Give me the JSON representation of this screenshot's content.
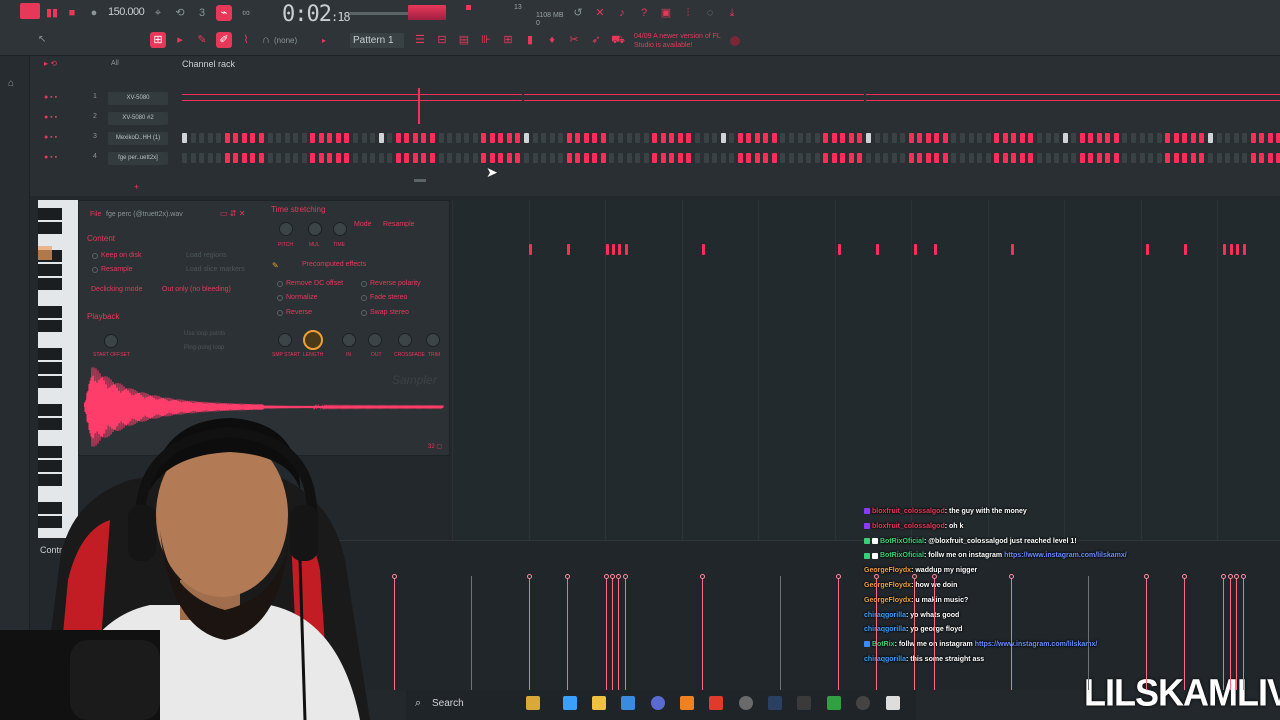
{
  "toolbar": {
    "tempo": "150.000",
    "time": "0:02",
    "time_frac": ":18",
    "cpu": "13",
    "memory": "1108 MB",
    "mem_sub": "0",
    "snap_label": "(none)",
    "pattern_label": "Pattern 1",
    "update_notice": "04/09 A newer version of FL Studio is available!",
    "accent_color": "#e8385a"
  },
  "rack": {
    "title": "Channel rack",
    "filter": "All",
    "channels": [
      {
        "num": "1",
        "name": "XV-5080"
      },
      {
        "num": "2",
        "name": "XV-5080 #2"
      },
      {
        "num": "3",
        "name": "MexikoD..HH (1)"
      },
      {
        "num": "4",
        "name": "fge per..uett2x]"
      }
    ]
  },
  "sampler": {
    "file_label": "File",
    "file_name": "fge perc (@truett2x).wav",
    "content_label": "Content",
    "keep_on_disk": "Keep on disk",
    "resample": "Resample",
    "load_regions": "Load regions",
    "load_slice_markers": "Load slice markers",
    "declicking_label": "Declicking mode",
    "declicking_value": "Out only (no bleeding)",
    "playback_label": "Playback",
    "use_loop_points": "Use loop points",
    "ping_pong_loop": "Ping-pong loop",
    "start_offset": "START OFFSET",
    "time_stretching": "Time stretching",
    "mode_label": "Mode",
    "mode_value": "Resample",
    "pitch": "PITCH",
    "mul": "MUL",
    "time": "TIME",
    "precomputed": "Precomputed effects",
    "remove_dc": "Remove DC offset",
    "reverse_polarity": "Reverse polarity",
    "normalize": "Normalize",
    "fade_stereo": "Fade stereo",
    "reverse": "Reverse",
    "swap_stereo": "Swap stereo",
    "knob_labels": [
      "SMP START",
      "LENGTH",
      "IN",
      "OUT",
      "CROSSFADE",
      "TRIM"
    ],
    "logo": "Sampler",
    "bit_label": "32"
  },
  "events": {
    "control_label": "Control"
  },
  "chat": [
    {
      "user": "bloxfruit_colossalgod",
      "msg": ": the guy with the money",
      "color": "#e8385a",
      "badges": [
        "#8a3aff"
      ],
      "link": ""
    },
    {
      "user": "bloxfruit_colossalgod",
      "msg": ": oh k",
      "color": "#e8385a",
      "badges": [
        "#8a3aff"
      ],
      "link": ""
    },
    {
      "user": "BotRixOficial",
      "msg": ": @bloxfruit_colossalgod just reached level 1!",
      "color": "#3ad07a",
      "badges": [
        "#3ad07a",
        "#ffffff"
      ],
      "link": ""
    },
    {
      "user": "BotRixOficial",
      "msg": ": follw me on instagram ",
      "color": "#3ad07a",
      "badges": [
        "#3ad07a",
        "#ffffff"
      ],
      "link": "https://www.instagram.com/lilskamx/"
    },
    {
      "user": "GeorgeFloydx",
      "msg": ": waddup my nigger",
      "color": "#f0a040",
      "badges": [],
      "link": ""
    },
    {
      "user": "GeorgeFloydx",
      "msg": ": how we doin",
      "color": "#f0a040",
      "badges": [],
      "link": ""
    },
    {
      "user": "GeorgeFloydx",
      "msg": ": u makin music?",
      "color": "#f0a040",
      "badges": [],
      "link": ""
    },
    {
      "user": "chiraqgorilla",
      "msg": ": yo whats good",
      "color": "#3aa0ff",
      "badges": [],
      "link": ""
    },
    {
      "user": "chiraqgorilla",
      "msg": ": yo george floyd",
      "color": "#3aa0ff",
      "badges": [],
      "link": ""
    },
    {
      "user": "BotRix",
      "msg": ": follw me on instagram ",
      "color": "#3ad07a",
      "badges": [
        "#3a8aff"
      ],
      "link": "https://www.instagram.com/lilskamx/"
    },
    {
      "user": "chiraqgorilla",
      "msg": ": this some straight ass",
      "color": "#3aa0ff",
      "badges": [],
      "link": ""
    }
  ],
  "taskbar": {
    "search_label": "Search"
  },
  "brand": "LILSKAMLIVE"
}
